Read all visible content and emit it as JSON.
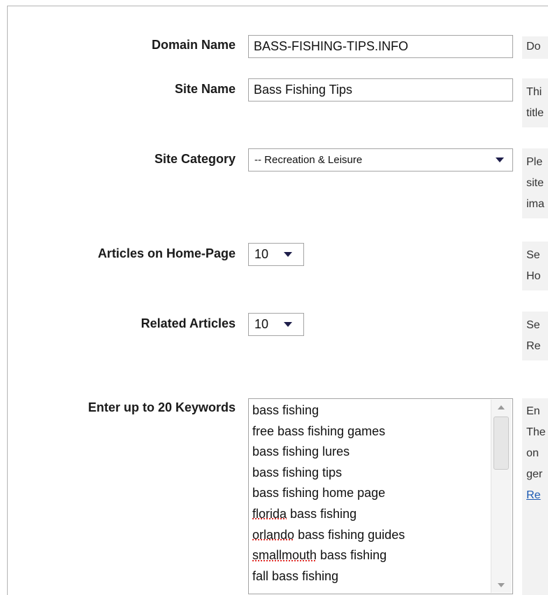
{
  "form": {
    "domain_name": {
      "label": "Domain Name",
      "value": "BASS-FISHING-TIPS.INFO",
      "help": [
        "Do"
      ]
    },
    "site_name": {
      "label": "Site Name",
      "value": "Bass Fishing Tips",
      "help": [
        "Thi",
        "title"
      ]
    },
    "site_category": {
      "label": "Site Category",
      "value": "-- Recreation & Leisure",
      "help": [
        "Ple",
        "site",
        "ima"
      ]
    },
    "articles_home": {
      "label": "Articles on Home-Page",
      "value": "10",
      "help": [
        "Se",
        "Ho"
      ]
    },
    "related_articles": {
      "label": "Related Articles",
      "value": "10",
      "help": [
        "Se",
        "Re"
      ]
    },
    "keywords": {
      "label": "Enter up to 20 Keywords",
      "lines": [
        "bass fishing",
        "free bass fishing games",
        "bass fishing lures",
        "bass fishing tips",
        "bass fishing home page",
        "florida bass fishing",
        "orlando bass fishing guides",
        "smallmouth bass fishing",
        "fall bass fishing"
      ],
      "misspelled_words": [
        "florida",
        "orlando",
        "smallmouth"
      ],
      "help": [
        "En",
        "The",
        "on",
        "ger"
      ],
      "help_link": "Re"
    }
  }
}
